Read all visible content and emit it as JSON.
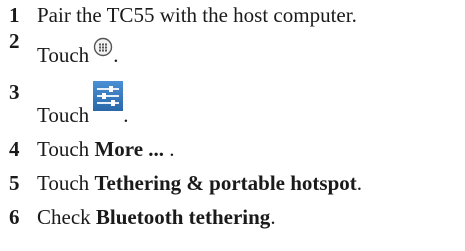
{
  "steps": [
    {
      "number": "1",
      "text": "Pair the TC55 with the host computer."
    },
    {
      "number": "2",
      "prefix": "Touch",
      "suffix": ".",
      "icon": "all-apps-icon"
    },
    {
      "number": "3",
      "prefix": "Touch",
      "suffix": ".",
      "icon": "settings-icon"
    },
    {
      "number": "4",
      "prefix": "Touch ",
      "bold": "More ...",
      "suffix": " ."
    },
    {
      "number": "5",
      "prefix": "Touch ",
      "bold": "Tethering & portable hotspot",
      "suffix": "."
    },
    {
      "number": "6",
      "prefix": "Check ",
      "bold": "Bluetooth tethering",
      "suffix": "."
    }
  ],
  "colors": {
    "text": "#1a1a1a",
    "settings_icon_bg": "#3a7fc1",
    "apps_icon_stroke": "#555555"
  }
}
